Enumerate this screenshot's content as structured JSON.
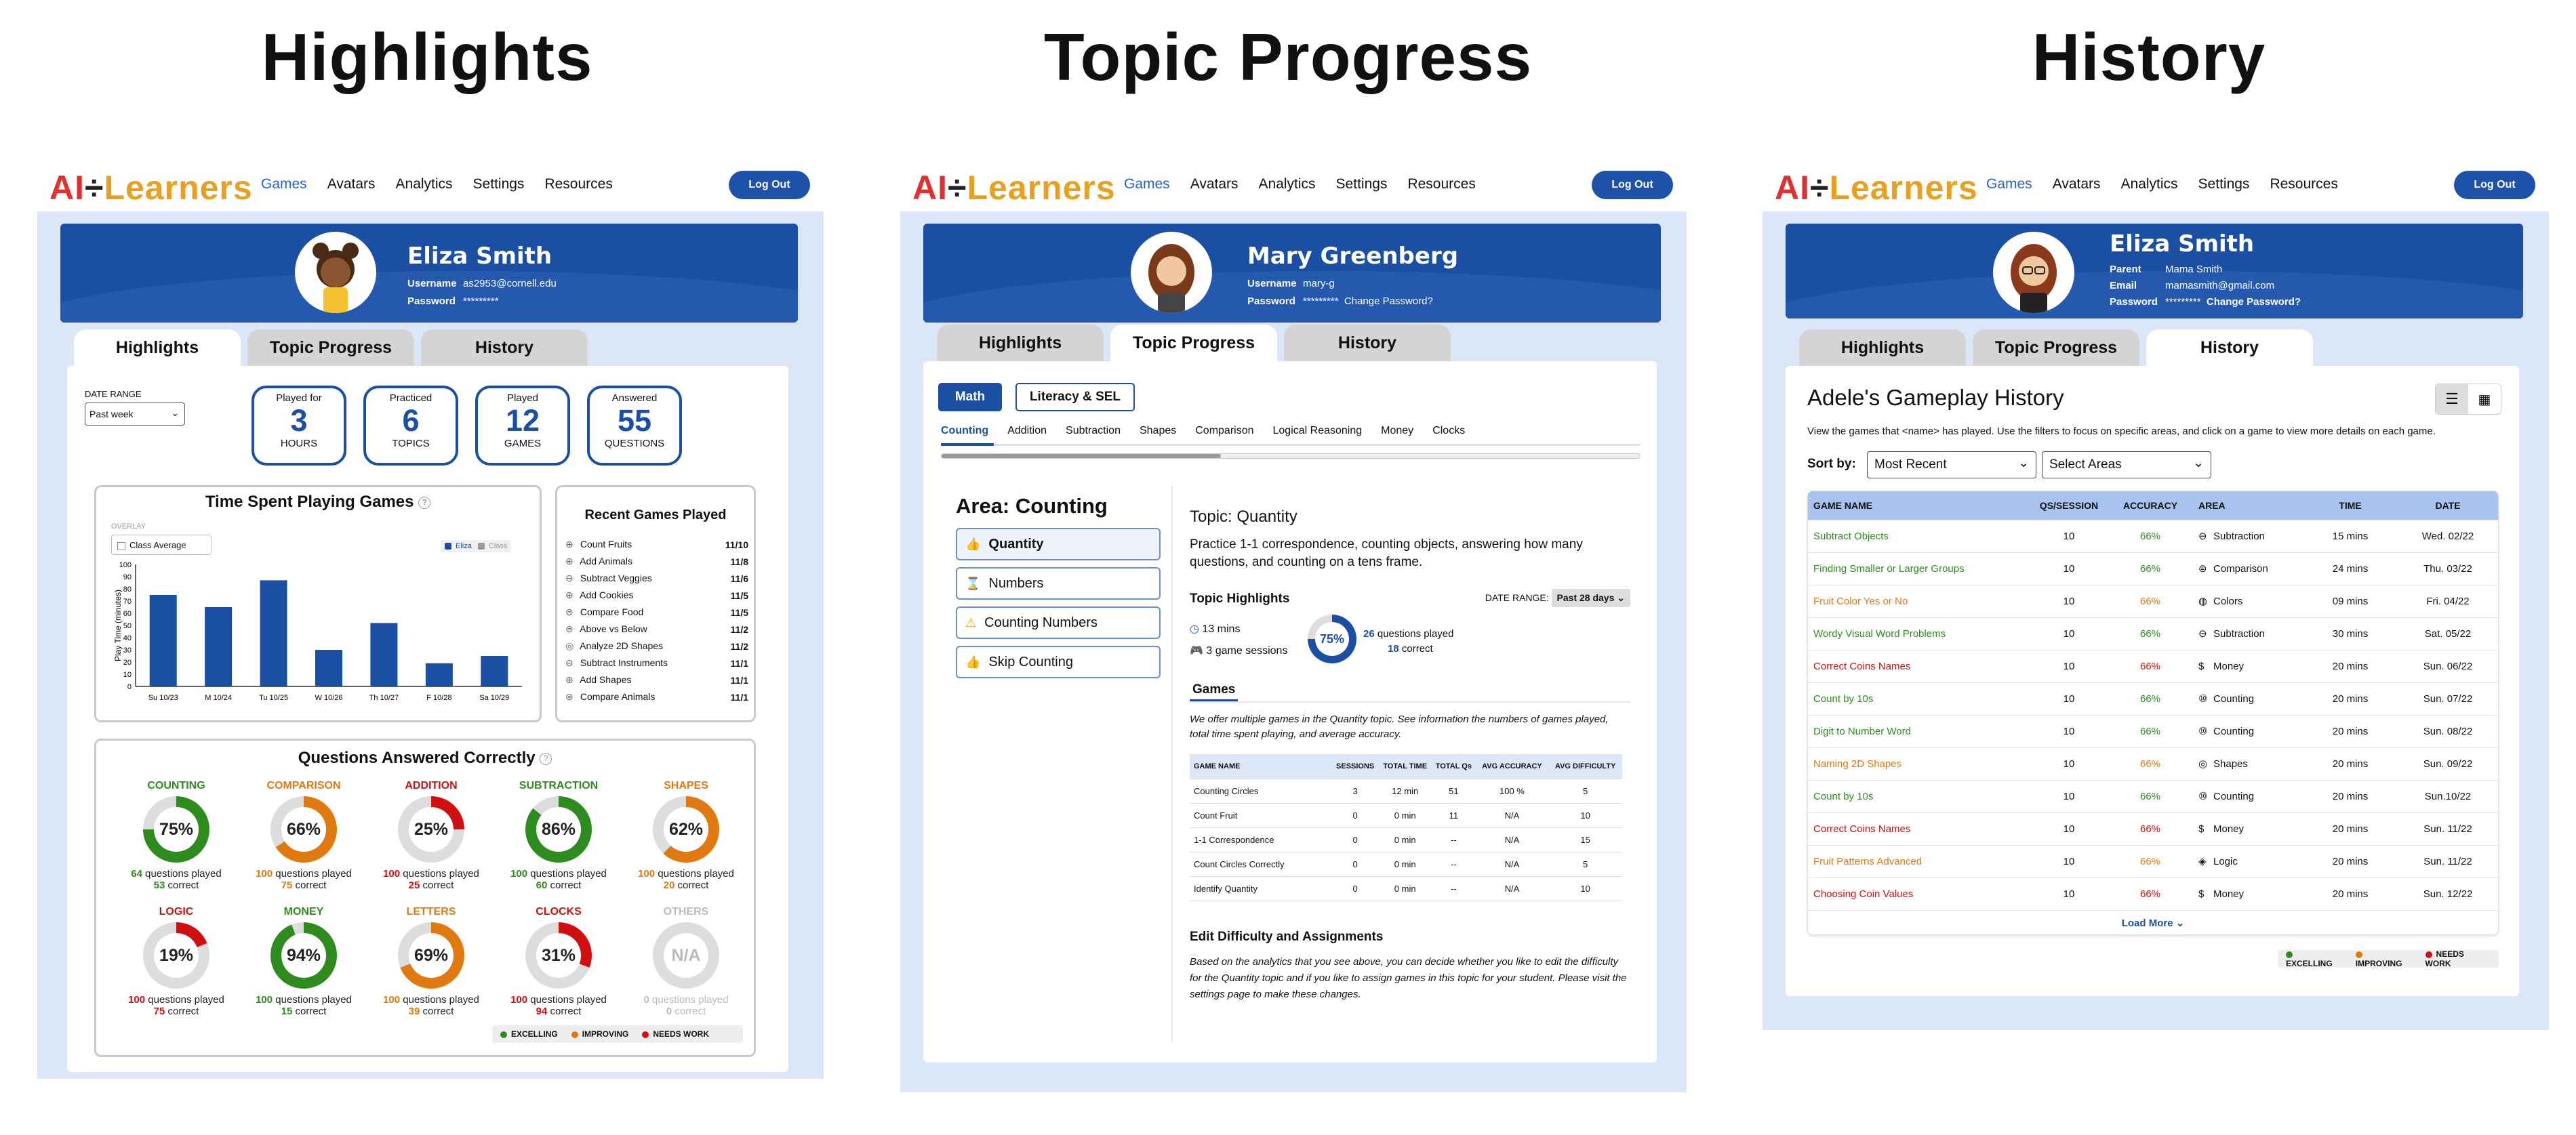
{
  "titles": {
    "highlights": "Highlights",
    "topic": "Topic Progress",
    "history": "History"
  },
  "nav": {
    "logo_ai": "AI",
    "logo_div": "÷",
    "logo_learners": "Learners",
    "links": [
      "Games",
      "Avatars",
      "Analytics",
      "Settings",
      "Resources"
    ],
    "logout": "Log Out"
  },
  "tabs": [
    "Highlights",
    "Topic Progress",
    "History"
  ],
  "colors": {
    "excelling": "#2e8b1e",
    "improving": "#e07a10",
    "needs_work": "#d01010",
    "primary": "#1a4fa3"
  },
  "legend": {
    "excelling": "EXCELLING",
    "improving": "IMPROVING",
    "needs_work": "NEEDS WORK"
  },
  "p1": {
    "name": "Eliza Smith",
    "username_label": "Username",
    "username": "as2953@cornell.edu",
    "password_label": "Password",
    "password": "*********",
    "date_range_label": "DATE RANGE",
    "date_range": "Past week",
    "stats": [
      {
        "label": "Played for",
        "value": "3",
        "unit": "HOURS"
      },
      {
        "label": "Practiced",
        "value": "6",
        "unit": "TOPICS"
      },
      {
        "label": "Played",
        "value": "12",
        "unit": "GAMES"
      },
      {
        "label": "Answered",
        "value": "55",
        "unit": "QUESTIONS"
      }
    ],
    "chart_title": "Time Spent Playing Games",
    "overlay_label": "OVERLAY",
    "class_avg": "Class Average",
    "legend_eliza": "Eliza",
    "legend_class": "Class",
    "recent_title": "Recent Games Played",
    "recent": [
      {
        "icon": "plus-icon",
        "name": "Count Fruits",
        "date": "11/10"
      },
      {
        "icon": "plus-icon",
        "name": "Add Animals",
        "date": "11/8"
      },
      {
        "icon": "minus-icon",
        "name": "Subtract Veggies",
        "date": "11/6"
      },
      {
        "icon": "plus-icon",
        "name": "Add Cookies",
        "date": "11/5"
      },
      {
        "icon": "compare-icon",
        "name": "Compare Food",
        "date": "11/5"
      },
      {
        "icon": "compare-icon",
        "name": "Above vs Below",
        "date": "11/2"
      },
      {
        "icon": "shapes-icon",
        "name": "Analyze 2D Shapes",
        "date": "11/2"
      },
      {
        "icon": "minus-icon",
        "name": "Subtract Instruments",
        "date": "11/1"
      },
      {
        "icon": "plus-icon",
        "name": "Add Shapes",
        "date": "11/1"
      },
      {
        "icon": "compare-icon",
        "name": "Compare Animals",
        "date": "11/1"
      }
    ],
    "qa_title": "Questions Answered Correctly",
    "donuts": [
      {
        "label": "COUNTING",
        "pct": 75,
        "text": "75%",
        "status": "excelling",
        "played": "64",
        "correct": "53"
      },
      {
        "label": "COMPARISON",
        "pct": 66,
        "text": "66%",
        "status": "improving",
        "played": "100",
        "correct": "75"
      },
      {
        "label": "ADDITION",
        "pct": 25,
        "text": "25%",
        "status": "needs_work",
        "played": "100",
        "correct": "25"
      },
      {
        "label": "SUBTRACTION",
        "pct": 86,
        "text": "86%",
        "status": "excelling",
        "played": "100",
        "correct": "60"
      },
      {
        "label": "SHAPES",
        "pct": 62,
        "text": "62%",
        "status": "improving",
        "played": "100",
        "correct": "20"
      },
      {
        "label": "LOGIC",
        "pct": 19,
        "text": "19%",
        "status": "needs_work",
        "played": "100",
        "correct": "75"
      },
      {
        "label": "MONEY",
        "pct": 94,
        "text": "94%",
        "status": "excelling",
        "played": "100",
        "correct": "15"
      },
      {
        "label": "LETTERS",
        "pct": 69,
        "text": "69%",
        "status": "improving",
        "played": "100",
        "correct": "39"
      },
      {
        "label": "CLOCKS",
        "pct": 31,
        "text": "31%",
        "status": "needs_work",
        "played": "100",
        "correct": "94"
      },
      {
        "label": "OTHERS",
        "pct": 0,
        "text": "N/A",
        "status": "none",
        "played": "0",
        "correct": "0"
      }
    ],
    "qp_suffix": "questions played",
    "corr_suffix": "correct"
  },
  "chart_data": {
    "type": "bar",
    "title": "Time Spent Playing Games",
    "ylabel": "Play Time (minutes)",
    "xlabel": "",
    "categories": [
      "Su 10/23",
      "M 10/24",
      "Tu 10/25",
      "W 10/26",
      "Th 10/27",
      "F 10/28",
      "Sa 10/29"
    ],
    "yticks": [
      "0",
      "10",
      "20",
      "30",
      "40",
      "50",
      "60",
      "70",
      "80",
      "90",
      "100"
    ],
    "ylim": [
      0,
      100
    ],
    "series": [
      {
        "name": "Eliza",
        "values": [
          75,
          65,
          87,
          30,
          52,
          19,
          25
        ]
      }
    ]
  },
  "p2": {
    "name": "Mary Greenberg",
    "username_label": "Username",
    "username": "mary-g",
    "password_label": "Password",
    "password": "*********",
    "change_pw": "Change Password?",
    "subjects": [
      "Math",
      "Literacy & SEL"
    ],
    "subtabs": [
      "Counting",
      "Addition",
      "Subtraction",
      "Shapes",
      "Comparison",
      "Logical Reasoning",
      "Money",
      "Clocks"
    ],
    "area_title": "Area: Counting",
    "areas": [
      {
        "icon": "thumbs-up-icon",
        "label": "Quantity"
      },
      {
        "icon": "hourglass-icon",
        "label": "Numbers"
      },
      {
        "icon": "warning-icon",
        "label": "Counting Numbers"
      },
      {
        "icon": "thumbs-up-icon",
        "label": "Skip Counting"
      }
    ],
    "topic_title": "Topic: Quantity",
    "topic_desc": "Practice 1-1 correspondence, counting objects, answering how many questions, and counting on a tens frame.",
    "highlights_title": "Topic Highlights",
    "date_range_label": "DATE RANGE:",
    "date_range": "Past 28 days",
    "mins": "13 mins",
    "sessions": "3 game sessions",
    "pct": "75%",
    "qplayed": "26",
    "qplayed_suffix": "questions played",
    "correct": "18",
    "correct_suffix": "correct",
    "games_title": "Games",
    "games_desc": "We offer multiple games in the Quantity topic. See information the numbers of games played, total time spent playing, and average accuracy.",
    "cols": [
      "GAME NAME",
      "SESSIONS",
      "TOTAL TIME",
      "TOTAL Qs",
      "AVG ACCURACY",
      "AVG DIFFICULTY"
    ],
    "rows": [
      [
        "Counting Circles",
        "3",
        "12 min",
        "51",
        "100 %",
        "5"
      ],
      [
        "Count Fruit",
        "0",
        "0 min",
        "11",
        "N/A",
        "10"
      ],
      [
        "1-1 Correspondence",
        "0",
        "0 min",
        "--",
        "N/A",
        "15"
      ],
      [
        "Count Circles Correctly",
        "0",
        "0 min",
        "--",
        "N/A",
        "5"
      ],
      [
        "Identify Quantity",
        "0",
        "0 min",
        "--",
        "N/A",
        "10"
      ]
    ],
    "edit_title": "Edit Difficulty and Assignments",
    "edit_desc": "Based on the analytics that you see above, you can decide whether you like to edit the difficulty for the Quantity topic and if you like to assign games in this topic for your student. Please visit the settings page to make these changes."
  },
  "p3": {
    "name": "Eliza Smith",
    "parent_label": "Parent",
    "parent": "Mama Smith",
    "email_label": "Email",
    "email": "mamasmith@gmail.com",
    "password_label": "Password",
    "password": "*********",
    "change_pw": "Change Password?",
    "title": "Adele's Gameplay History",
    "desc": "View the games that <name> has played. Use the filters to focus on specific areas, and click on a game to view more details on each game.",
    "sort_label": "Sort by:",
    "sort": "Most Recent",
    "area": "Select Areas",
    "cols": [
      "GAME NAME",
      "QS/SESSION",
      "ACCURACY",
      "AREA",
      "TIME",
      "DATE"
    ],
    "rows": [
      {
        "name": "Subtract Objects",
        "status": "excelling",
        "qs": "10",
        "acc": "66%",
        "icon": "minus-icon",
        "area": "Subtraction",
        "time": "15 mins",
        "date": "Wed. 02/22"
      },
      {
        "name": "Finding Smaller or Larger Groups",
        "status": "excelling",
        "qs": "10",
        "acc": "66%",
        "icon": "compare-icon",
        "area": "Comparison",
        "time": "24 mins",
        "date": "Thu. 03/22"
      },
      {
        "name": "Fruit Color Yes or No",
        "status": "improving",
        "qs": "10",
        "acc": "66%",
        "icon": "palette-icon",
        "area": "Colors",
        "time": "09 mins",
        "date": "Fri. 04/22"
      },
      {
        "name": "Wordy Visual Word Problems",
        "status": "excelling",
        "qs": "10",
        "acc": "66%",
        "icon": "minus-icon",
        "area": "Subtraction",
        "time": "30 mins",
        "date": "Sat. 05/22"
      },
      {
        "name": "Correct Coins Names",
        "status": "needs_work",
        "qs": "10",
        "acc": "66%",
        "icon": "dollar-icon",
        "area": "Money",
        "time": "20 mins",
        "date": "Sun. 06/22"
      },
      {
        "name": "Count by 10s",
        "status": "excelling",
        "qs": "10",
        "acc": "66%",
        "icon": "counting-icon",
        "area": "Counting",
        "time": "20 mins",
        "date": "Sun. 07/22"
      },
      {
        "name": "Digit to Number Word",
        "status": "excelling",
        "qs": "10",
        "acc": "66%",
        "icon": "counting-icon",
        "area": "Counting",
        "time": "20 mins",
        "date": "Sun. 08/22"
      },
      {
        "name": "Naming 2D Shapes",
        "status": "improving",
        "qs": "10",
        "acc": "66%",
        "icon": "shapes-icon",
        "area": "Shapes",
        "time": "20 mins",
        "date": "Sun. 09/22"
      },
      {
        "name": "Count by 10s",
        "status": "excelling",
        "qs": "10",
        "acc": "66%",
        "icon": "counting-icon",
        "area": "Counting",
        "time": "20 mins",
        "date": "Sun.10/22"
      },
      {
        "name": "Correct Coins Names",
        "status": "needs_work",
        "qs": "10",
        "acc": "66%",
        "icon": "dollar-icon",
        "area": "Money",
        "time": "20 mins",
        "date": "Sun. 11/22"
      },
      {
        "name": "Fruit Patterns Advanced",
        "status": "improving",
        "qs": "10",
        "acc": "66%",
        "icon": "logic-icon",
        "area": "Logic",
        "time": "20 mins",
        "date": "Sun. 11/22"
      },
      {
        "name": "Choosing Coin Values",
        "status": "needs_work",
        "qs": "10",
        "acc": "66%",
        "icon": "dollar-icon",
        "area": "Money",
        "time": "20 mins",
        "date": "Sun. 12/22"
      }
    ],
    "load_more": "Load More"
  }
}
